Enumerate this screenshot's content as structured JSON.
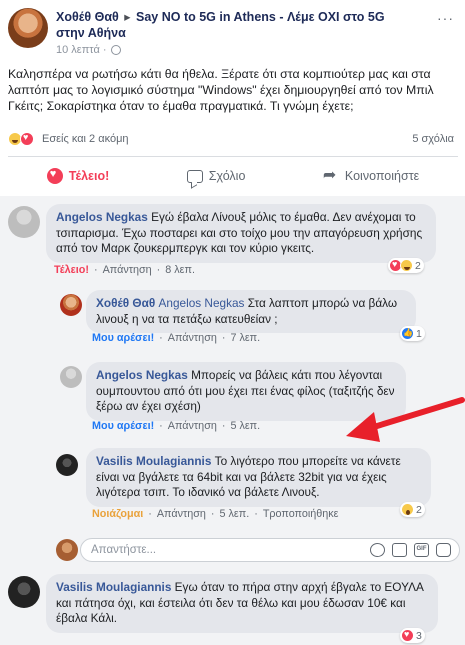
{
  "post": {
    "author": "Χοθέθ Θαθ",
    "arrow": "▸",
    "group": "Say NO to 5G in Athens - Λέμε ΟΧΙ στο 5G στην Αθήνα",
    "time": "10 λεπτά ·",
    "more": "···",
    "body": "Καλησπέρα να ρωτήσω κάτι θα ήθελα. Ξέρατε ότι στα κομπιούτερ μας και στα λαπτόπ μας το λογισμικό σύστημα \"Windows\" έχει δημιουργηθεί από τον Μπιλ Γκέιτς; Σοκαρίστηκα όταν το έμαθα πραγματικά. Τι γνώμη έχετε;",
    "reactions_text": "Εσείς και 2 ακόμη",
    "comments_count": "5 σχόλια"
  },
  "actions": {
    "love": "Τέλειο!",
    "comment": "Σχόλιο",
    "share": "Κοινοποιήστε"
  },
  "comments": [
    {
      "author": "Angelos Negkas",
      "text": "Εγώ έβαλα Λίνουξ μόλις το έμαθα. Δεν ανέχομαι το τσιπαρισμα. Έχω ποσταρει και στο τοίχο μου την απαγόρευση χρήσης από τον Μαρκ ζουκερμπεργκ και τον κύριο γκειτς.",
      "reaction_label": "Τέλειο!",
      "reply": "Απάντηση",
      "time": "8 λεπ.",
      "count": "2"
    },
    {
      "author": "Χοθέθ Θαθ",
      "mention": "Angelos Negkas",
      "text": " Στα λαπτοπ μπορώ να βάλω λινουξ η να τα πετάξω κατευθείαν ;",
      "reaction_label": "Μου αρέσει!",
      "reply": "Απάντηση",
      "time": "7 λεπ.",
      "count": "1"
    },
    {
      "author": "Angelos Negkas",
      "text": "Μπορείς να βάλεις κάτι που λέγονται ουμπουντου από ότι μου έχει πει ένας φίλος (ταξιτζής δεν ξέρω αν έχει σχέση)",
      "reaction_label": "Μου αρέσει!",
      "reply": "Απάντηση",
      "time": "5 λεπ."
    },
    {
      "author": "Vasilis Moulagiannis",
      "text": "Το λιγότερο που μπορείτε να κάνετε είναι να βγάλετε τα 64bit και να βάλετε 32bit για να έχεις λιγότερα τσιπ. Το ιδανικό να βάλετε Λινουξ.",
      "reaction_label": "Νοιάζομαι",
      "reply": "Απάντηση",
      "time": "5 λεπ.",
      "translate": "Τροποποιήθηκε",
      "count": "2"
    },
    {
      "author": "Vasilis Moulagiannis",
      "text": "Εγω όταν το πήρα στην αρχή έβγαλε το ΕΟΥΛΑ και πάτησα όχι, και έστειλα ότι δεν τα θέλω και μου έδωσαν 10€ και έβαλα Κάλι.",
      "count": "3"
    }
  ],
  "reply_input": {
    "placeholder": "Απαντήστε..."
  },
  "icons": {
    "globe": "globe-icon",
    "love": "love-react-icon",
    "comment": "comment-icon",
    "share": "share-icon",
    "emoji": "emoji-icon",
    "camera": "camera-icon",
    "gif": "gif-icon",
    "sticker": "sticker-icon",
    "gif_text": "GIF"
  },
  "colors": {
    "love": "#f33e58",
    "link": "#385898",
    "arrow": "#e8202a"
  }
}
